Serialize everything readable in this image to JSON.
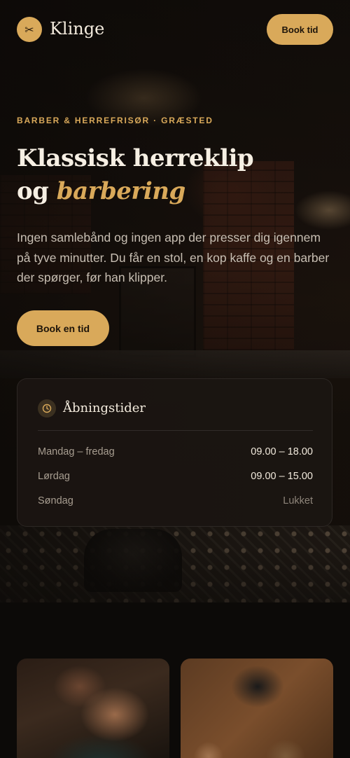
{
  "header": {
    "logo_icon": "scissors-icon",
    "logo_glyph": "✂",
    "brand": "Klinge",
    "book_label": "Book tid"
  },
  "hero": {
    "eyebrow": "BARBER & HERREFRISØR · GRÆSTED",
    "headline_line1": "Klassisk herreklip",
    "headline_line2_prefix": "og ",
    "headline_line2_accent": "barbering",
    "intro": "Ingen samlebånd og ingen app der presser dig igennem på tyve minutter. Du får en stol, en kop kaffe og en barber der spørger, før han klipper.",
    "book_label": "Book en tid"
  },
  "hours": {
    "icon": "clock-icon",
    "title": "Åbningstider",
    "rows": [
      {
        "day": "Mandag – fredag",
        "time": "09.00 – 18.00"
      },
      {
        "day": "Lørdag",
        "time": "09.00 – 15.00"
      },
      {
        "day": "Søndag",
        "time": "Lukket"
      }
    ]
  },
  "colors": {
    "accent": "#d9a95a",
    "background": "#0c0a08",
    "card": "#1b1612"
  }
}
